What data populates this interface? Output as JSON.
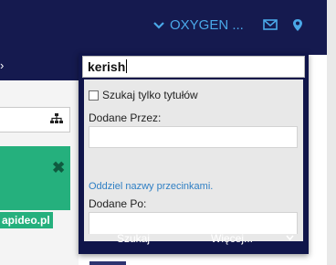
{
  "topbar": {
    "org_label": "OXYGEN ...",
    "icons": [
      "chevron-down-icon",
      "mail-icon",
      "location-pin-icon"
    ],
    "color_bg": "#151a4f",
    "color_accent": "#4aa8e8"
  },
  "nav": {
    "arrow": "›"
  },
  "left": {
    "tag_text": "apideo.pl",
    "close_glyph": "✖",
    "card_color": "#25b07d"
  },
  "search_panel": {
    "query_value": "kerish",
    "title_only_label": "Szukaj tylko tytułów",
    "title_only_checked": false,
    "added_by_label": "Dodane Przez:",
    "added_by_value": "",
    "hint": "Oddziel nazwy przecinkami.",
    "added_after_label": "Dodane Po:",
    "added_after_value": "",
    "search_button": "Szukaj",
    "more_button": "Więcej..."
  }
}
